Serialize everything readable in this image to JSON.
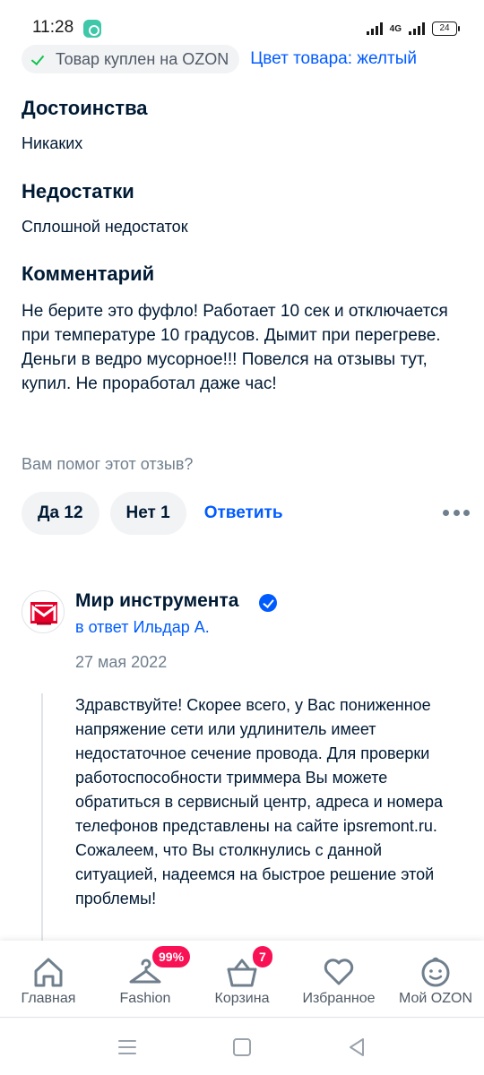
{
  "status_bar": {
    "time": "11:28",
    "network": "4G",
    "battery": "24"
  },
  "purchase": {
    "bought_label": "Товар куплен на OZON",
    "color_label": "Цвет товара: желтый"
  },
  "review": {
    "pros_title": "Достоинства",
    "pros_text": "Никаких",
    "cons_title": "Недостатки",
    "cons_text": "Сплошной недостаток",
    "comment_title": "Комментарий",
    "comment_text": "Не берите это фуфло! Работает 10 сек и отключается при температуре 10 градусов. Дымит при перегреве. Деньги в ведро мусорное!!! Повелся на отзывы тут, купил. Не проработал даже час!",
    "helpful_question": "Вам помог этот отзыв?",
    "yes_label": "Да 12",
    "no_label": "Нет 1",
    "reply_label": "Ответить"
  },
  "seller_reply": {
    "seller_name": "Мир инструмента",
    "reply_to": "в ответ Ильдар А.",
    "date": "27 мая 2022",
    "text": "Здравствуйте! Скорее всего, у Вас пониженное напряжение сети или удлинитель имеет недостаточное сечение провода. Для проверки работоспособности триммера Вы можете обратиться в сервисный центр, адреса и номера телефонов представлены на сайте ipsremont.ru. Сожалеем, что Вы столкнулись с данной ситуацией, надеемся на быстрое решение этой проблемы!"
  },
  "bottom_nav": {
    "items": [
      {
        "label": "Главная",
        "icon": "home-icon"
      },
      {
        "label": "Fashion",
        "icon": "hanger-icon",
        "badge": "99%"
      },
      {
        "label": "Корзина",
        "icon": "basket-icon",
        "badge": "7"
      },
      {
        "label": "Избранное",
        "icon": "heart-icon"
      },
      {
        "label": "Мой OZON",
        "icon": "profile-icon"
      }
    ]
  },
  "colors": {
    "accent": "#005bff",
    "text": "#001a34",
    "muted": "#707f8d",
    "badge": "#f91155",
    "success": "#10c44c"
  }
}
